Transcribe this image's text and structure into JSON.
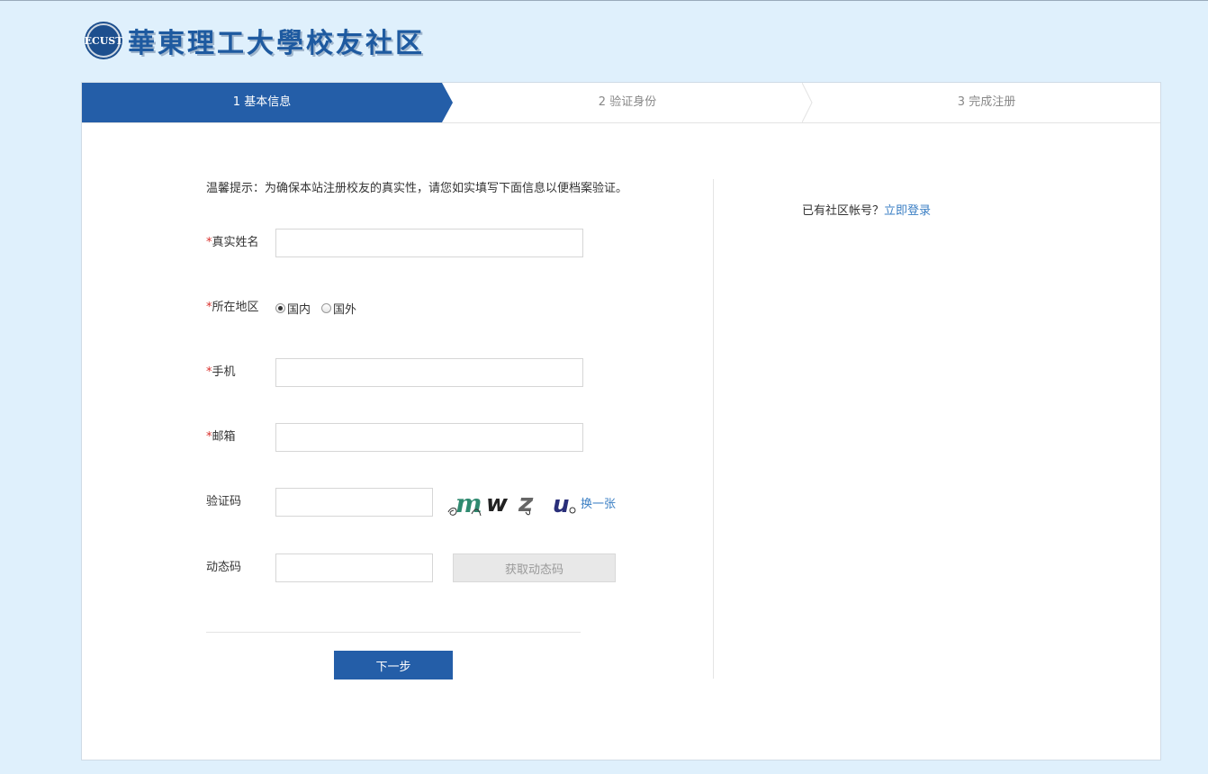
{
  "header": {
    "seal_text": "ECUST",
    "logo_text": "華東理工大學校友社区"
  },
  "steps": [
    {
      "label": "1 基本信息",
      "active": true
    },
    {
      "label": "2 验证身份",
      "active": false
    },
    {
      "label": "3 完成注册",
      "active": false
    }
  ],
  "form": {
    "notice": "温馨提示：为确保本站注册校友的真实性，请您如实填写下面信息以便档案验证。",
    "required_mark": "*",
    "name_label": "真实姓名",
    "name_value": "",
    "region_label": "所在地区",
    "region_options": [
      "国内",
      "国外"
    ],
    "region_selected": "国内",
    "phone_label": "手机",
    "phone_value": "",
    "email_label": "邮箱",
    "email_value": "",
    "captcha_label": "验证码",
    "captcha_value": "",
    "captcha_text": "mwzu",
    "captcha_refresh": "换一张",
    "sms_label": "动态码",
    "sms_value": "",
    "sms_button": "获取动态码",
    "next_button": "下一步"
  },
  "sidebar": {
    "has_account": "已有社区帐号？",
    "login_link": "立即登录"
  },
  "colors": {
    "primary": "#245ea8",
    "link": "#3b7fc4",
    "required": "#d9302c",
    "page_bg": "#dff0fc"
  }
}
